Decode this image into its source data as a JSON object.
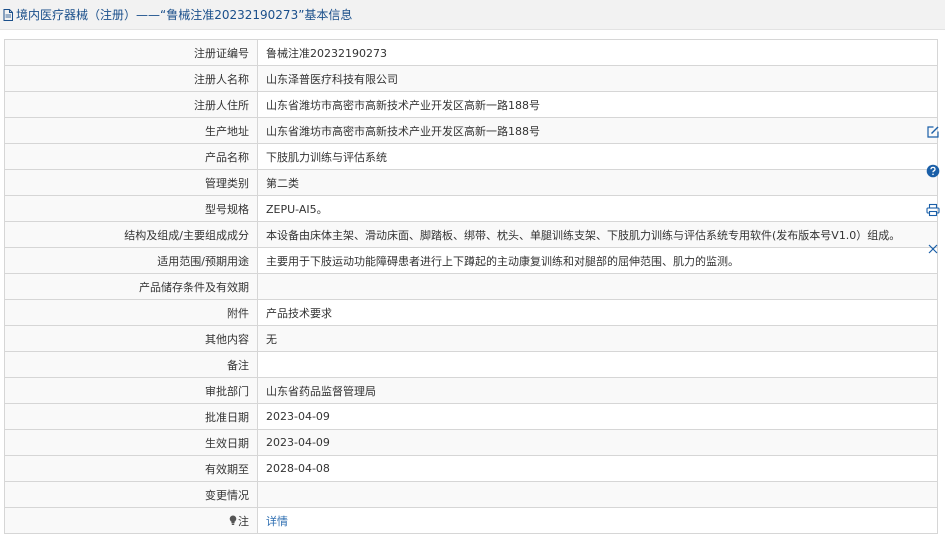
{
  "header": {
    "title": "境内医疗器械（注册）——“鲁械注准20232190273”基本信息"
  },
  "table": {
    "rows": [
      {
        "label": "注册证编号",
        "value": "鲁械注准20232190273"
      },
      {
        "label": "注册人名称",
        "value": "山东泽普医疗科技有限公司"
      },
      {
        "label": "注册人住所",
        "value": "山东省潍坊市高密市高新技术产业开发区高新一路188号"
      },
      {
        "label": "生产地址",
        "value": "山东省潍坊市高密市高新技术产业开发区高新一路188号"
      },
      {
        "label": "产品名称",
        "value": "下肢肌力训练与评估系统"
      },
      {
        "label": "管理类别",
        "value": "第二类"
      },
      {
        "label": "型号规格",
        "value": "ZEPU-AI5。"
      },
      {
        "label": "结构及组成/主要组成成分",
        "value": "本设备由床体主架、滑动床面、脚踏板、绑带、枕头、单腿训练支架、下肢肌力训练与评估系统专用软件(发布版本号V1.0）组成。"
      },
      {
        "label": "适用范围/预期用途",
        "value": "主要用于下肢运动功能障碍患者进行上下蹲起的主动康复训练和对腿部的屈伸范围、肌力的监测。"
      },
      {
        "label": "产品储存条件及有效期",
        "value": ""
      },
      {
        "label": "附件",
        "value": "产品技术要求"
      },
      {
        "label": "其他内容",
        "value": "无"
      },
      {
        "label": "备注",
        "value": ""
      },
      {
        "label": "审批部门",
        "value": "山东省药品监督管理局"
      },
      {
        "label": "批准日期",
        "value": "2023-04-09"
      },
      {
        "label": "生效日期",
        "value": "2023-04-09"
      },
      {
        "label": "有效期至",
        "value": "2028-04-08"
      },
      {
        "label": "变更情况",
        "value": ""
      }
    ],
    "note": {
      "label": "注",
      "link": "详情"
    }
  },
  "side_toolbar": {
    "icons": [
      "edit-icon",
      "help-icon",
      "print-icon",
      "close-icon"
    ],
    "accent": "#1a5fa8"
  },
  "colors": {
    "title": "#1a4f8b",
    "link": "#2b6cb0",
    "border": "#d6d6d6",
    "label_bg": "#f9f9f9"
  }
}
